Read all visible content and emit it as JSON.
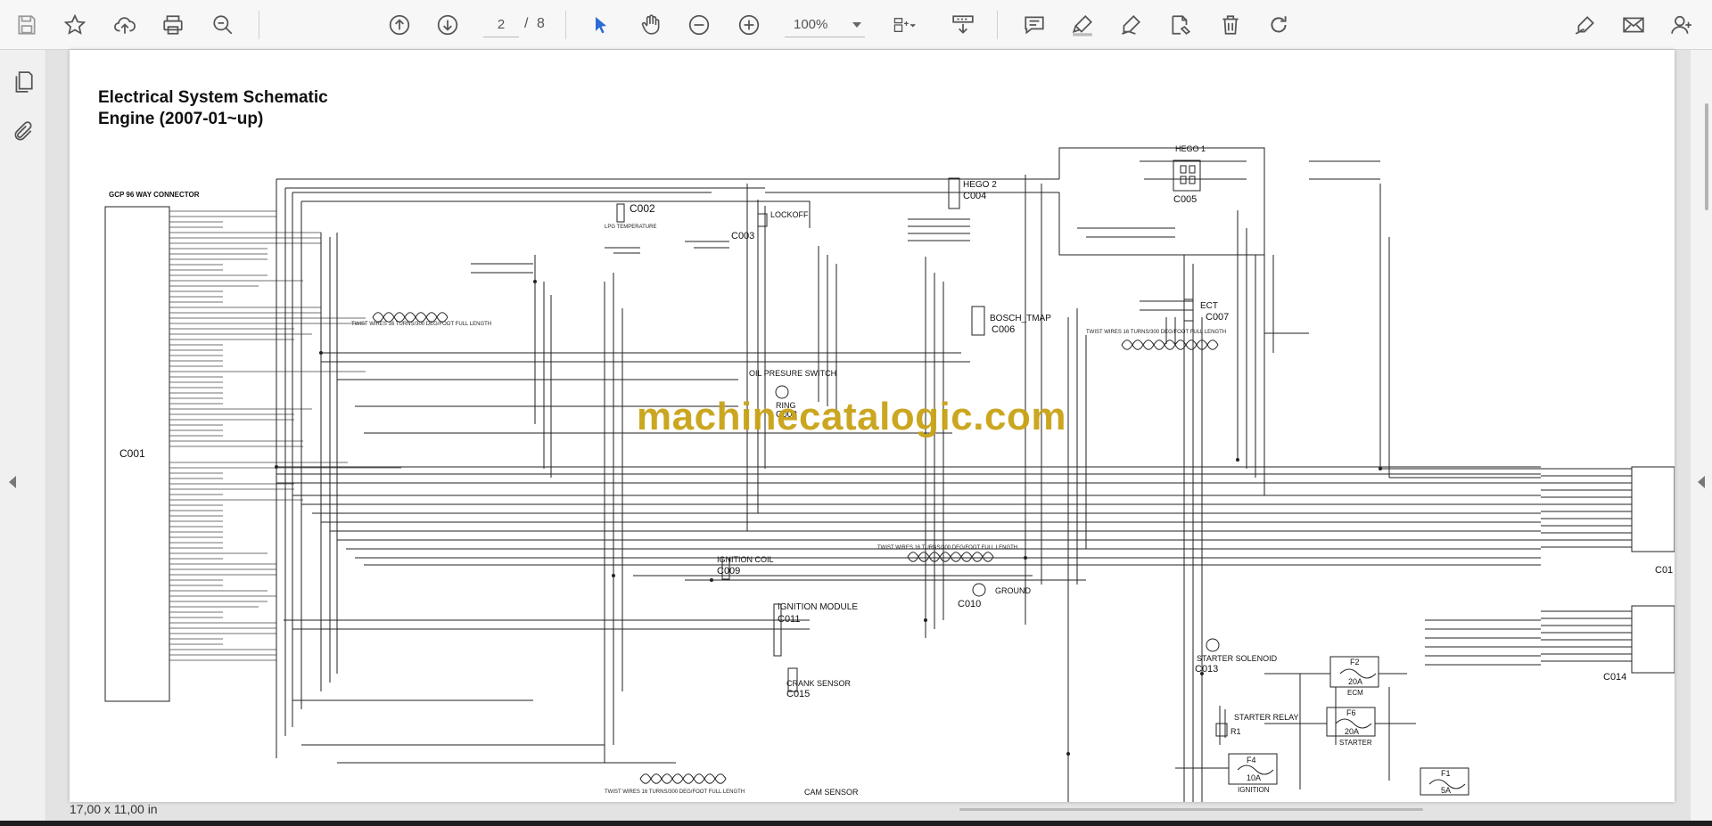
{
  "toolbar": {
    "page_current": "2",
    "page_separator": "/",
    "page_total": "8",
    "zoom_value": "100%",
    "icons": [
      "save-icon",
      "bookmark-star-icon",
      "cloud-upload-icon",
      "print-icon",
      "zoom-out-search-icon",
      "previous-page-icon",
      "next-page-icon",
      "select-cursor-icon",
      "hand-tool-icon",
      "zoom-minus-icon",
      "zoom-plus-icon",
      "fit-page-icon",
      "scroll-mode-icon",
      "comment-icon",
      "highlight-icon",
      "draw-icon",
      "stamp-icon",
      "delete-icon",
      "rotate-icon",
      "fill-sign-icon",
      "email-icon",
      "add-user-icon"
    ]
  },
  "document": {
    "title_line1": "Electrical System Schematic",
    "title_line2": "Engine (2007-01~up)",
    "watermark": "machinecatalogic.com",
    "labels": {
      "gcp": "GCP 96 WAY CONNECTOR",
      "c001": "C001",
      "c002": "C002",
      "lpg_temp": "LPG TEMPERATURE",
      "c003": "C003",
      "lockoff": "LOCKOFF",
      "hego2": "HEGO 2",
      "c004": "C004",
      "hego1": "HEGO 1",
      "c005": "C005",
      "ect": "ECT",
      "c007": "C007",
      "bosch": "BOSCH_TMAP",
      "c006": "C006",
      "oil": "OIL PRESURE SWITCH",
      "ring": "RING",
      "c008": "C008",
      "ign_coil": "IGNITION COIL",
      "c009": "C009",
      "ign_module": "IGNITION MODULE",
      "c011": "C011",
      "ground": "GROUND",
      "c010": "C010",
      "starter_sol": "STARTER SOLENOID",
      "c013": "C013",
      "f2": "F2",
      "f2_amp": "20A",
      "ecm": "ECM",
      "f6": "F6",
      "f6_amp": "20A",
      "starter": "STARTER",
      "starter_relay": "STARTER RELAY",
      "r1": "R1",
      "f4": "F4",
      "f4_amp": "10A",
      "ignition": "IGNITION",
      "f1": "F1",
      "f1_amp": "5A",
      "crank": "CRANK SENSOR",
      "c015": "C015",
      "cam": "CAM SENSOR",
      "c014": "C014",
      "c01x": "C01",
      "twist1": "TWIST WIRES 16 TURNS/300 DEG/FOOT FULL LENGTH",
      "twist2": "TWIST WIRES 16 TURNS/300 DEG/FOOT FULL LENGTH",
      "twist3": "TWIST WIRES 16 TURNS/300 DEG/FOOT FULL LENGTH",
      "twist4": "TWIST WIRES 16 TURNS/300 DEG/FOOT FULL LENGTH"
    }
  },
  "status": {
    "page_size": "17,00 x 11,00 in"
  }
}
